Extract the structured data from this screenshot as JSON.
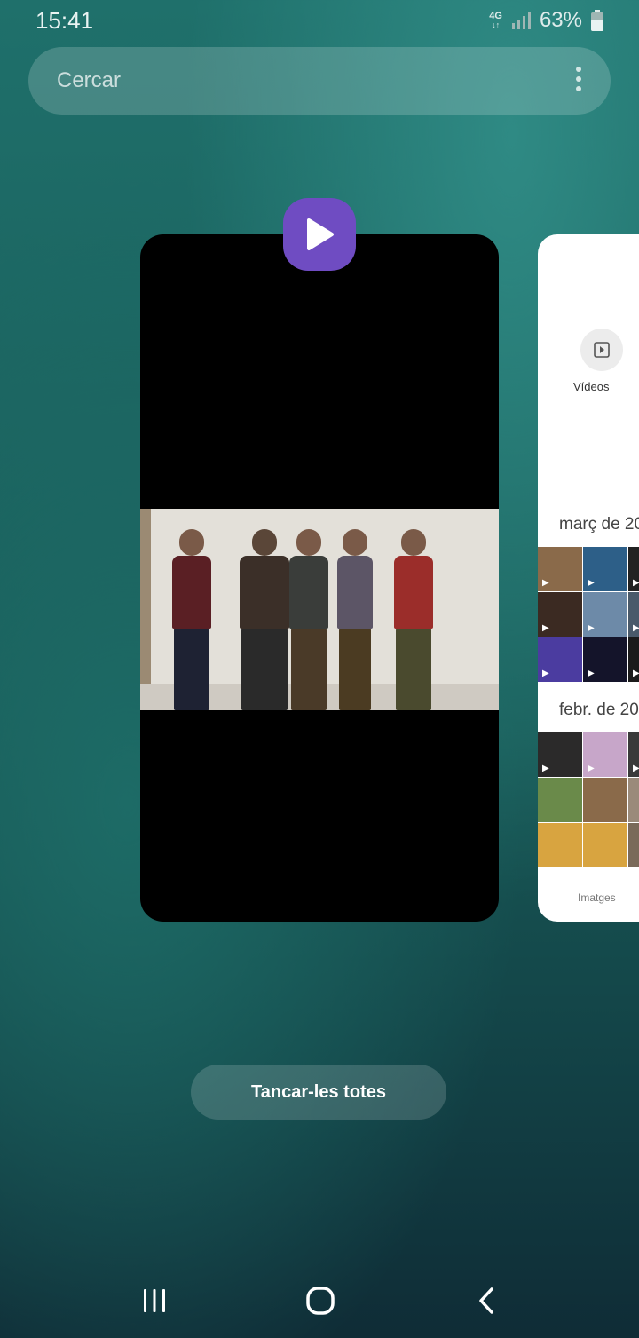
{
  "status_bar": {
    "time": "15:41",
    "network": "4G",
    "battery_percent": "63%"
  },
  "search": {
    "placeholder": "Cercar"
  },
  "recent_apps": {
    "main_card": {
      "app_icon": "play-icon",
      "app_icon_color": "#6f4cc2"
    },
    "side_card": {
      "videos_label": "Vídeos",
      "section_1_title": "març de 20",
      "section_2_title": "febr. de 20",
      "bottom_tab_label": "Imatges"
    }
  },
  "close_all_label": "Tancar-les totes",
  "navigation": {
    "recents_icon": "recents-icon",
    "home_icon": "home-icon",
    "back_icon": "back-icon"
  }
}
